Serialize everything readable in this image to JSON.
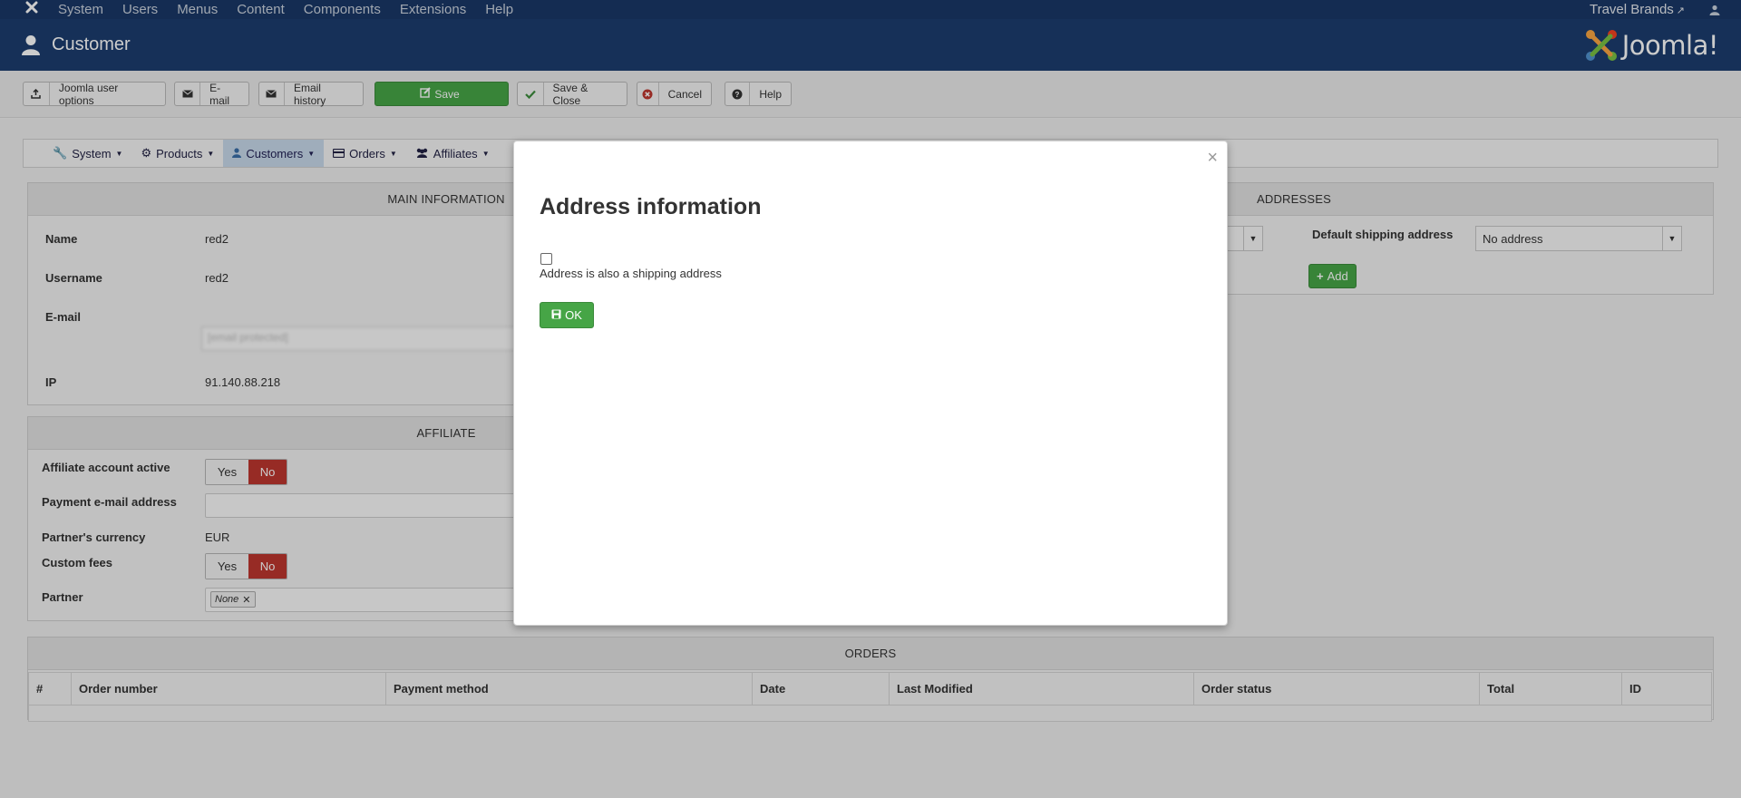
{
  "topnav": {
    "menu": [
      "System",
      "Users",
      "Menus",
      "Content",
      "Components",
      "Extensions",
      "Help"
    ],
    "site_name": "Travel Brands"
  },
  "header": {
    "title": "Customer",
    "brand": "Joomla!"
  },
  "toolbar": {
    "joomla_user_options": "Joomla user options",
    "email": "E-mail",
    "email_history": "Email history",
    "save": "Save",
    "save_close": "Save & Close",
    "cancel": "Cancel",
    "help": "Help"
  },
  "subnav": {
    "items": [
      "System",
      "Products",
      "Customers",
      "Orders",
      "Affiliates"
    ],
    "active": "Customers"
  },
  "main_info": {
    "heading": "MAIN INFORMATION",
    "name_label": "Name",
    "name_value": "red2",
    "username_label": "Username",
    "username_value": "red2",
    "email_label": "E-mail",
    "email_value": "[email protected]",
    "ip_label": "IP",
    "ip_value": "91.140.88.218"
  },
  "addresses": {
    "heading": "ADDRESSES",
    "default_shipping_label": "Default shipping address",
    "default_shipping_value": "No address",
    "add_button": "Add"
  },
  "affiliate": {
    "heading": "AFFILIATE",
    "account_active_label": "Affiliate account active",
    "payment_email_label": "Payment e-mail address",
    "currency_label": "Partner's currency",
    "currency_value": "EUR",
    "custom_fees_label": "Custom fees",
    "partner_label": "Partner",
    "partner_value": "None",
    "yes": "Yes",
    "no": "No"
  },
  "orders": {
    "heading": "ORDERS",
    "columns": [
      "#",
      "Order number",
      "Payment method",
      "Date",
      "Last Modified",
      "Order status",
      "Total",
      "ID"
    ]
  },
  "modal": {
    "title": "Address information",
    "checkbox_label": "Address is also a shipping address",
    "checkbox_checked": false,
    "ok_button": "OK",
    "close": "×"
  },
  "colors": {
    "topnav_bg": "#1a3867",
    "header_bg": "#1c3d6e",
    "success": "#46a546",
    "danger": "#bd362f"
  }
}
